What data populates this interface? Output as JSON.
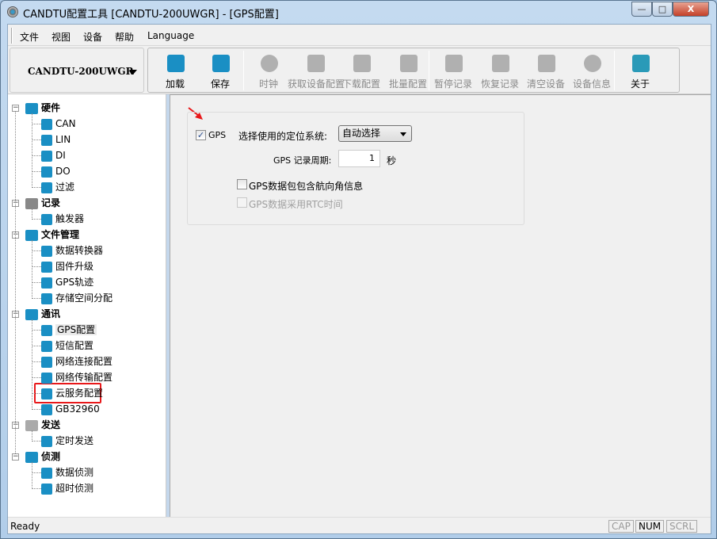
{
  "window": {
    "title": "CANDTU配置工具 [CANDTU-200UWGR] - [GPS配置]",
    "controls": {
      "minimize": "—",
      "maximize": "□",
      "close": "X"
    }
  },
  "menu": [
    "文件",
    "视图",
    "设备",
    "帮助",
    "Language"
  ],
  "device_selector": {
    "value": "CANDTU-200UWGR"
  },
  "toolbar": [
    {
      "label": "加载",
      "icon": "load-icon",
      "enabled": true
    },
    {
      "label": "保存",
      "icon": "save-icon",
      "enabled": true
    },
    {
      "label": "时钟",
      "icon": "clock-icon",
      "enabled": false
    },
    {
      "label": "获取设备配置",
      "icon": "get-config-icon",
      "enabled": false
    },
    {
      "label": "下载配置",
      "icon": "download-config-icon",
      "enabled": false
    },
    {
      "label": "批量配置",
      "icon": "batch-config-icon",
      "enabled": false
    },
    {
      "label": "暂停记录",
      "icon": "pause-icon",
      "enabled": false
    },
    {
      "label": "恢复记录",
      "icon": "play-icon",
      "enabled": false
    },
    {
      "label": "清空设备",
      "icon": "clear-icon",
      "enabled": false
    },
    {
      "label": "设备信息",
      "icon": "info-icon",
      "enabled": false
    },
    {
      "label": "关于",
      "icon": "about-icon",
      "enabled": true
    }
  ],
  "tree": [
    {
      "label": "硬件",
      "children": [
        "CAN",
        "LIN",
        "DI",
        "DO",
        "过滤"
      ]
    },
    {
      "label": "记录",
      "children": [
        "触发器"
      ]
    },
    {
      "label": "文件管理",
      "children": [
        "数据转换器",
        "固件升级",
        "GPS轨迹",
        "存储空间分配"
      ]
    },
    {
      "label": "通讯",
      "children": [
        "GPS配置",
        "短信配置",
        "网络连接配置",
        "网络传输配置",
        "云服务配置",
        "GB32960"
      ]
    },
    {
      "label": "发送",
      "children": [
        "定时发送"
      ]
    },
    {
      "label": "侦测",
      "children": [
        "数据侦测",
        "超时侦测"
      ]
    }
  ],
  "selected_node": "GPS配置",
  "gps": {
    "enable_label": "GPS",
    "enabled": true,
    "system_label": "选择使用的定位系统:",
    "system_value": "自动选择",
    "period_label": "GPS 记录周期:",
    "period_value": "1",
    "period_unit": "秒",
    "heading_label": "GPS数据包包含航向角信息",
    "heading_checked": false,
    "rtc_label": "GPS数据采用RTC时间",
    "rtc_checked": false,
    "rtc_enabled": false
  },
  "status": {
    "text": "Ready",
    "indicators": [
      {
        "label": "CAP",
        "active": false
      },
      {
        "label": "NUM",
        "active": true
      },
      {
        "label": "SCRL",
        "active": false
      }
    ]
  },
  "colors": {
    "accent": "#1a8fc4",
    "highlight": "#e8181a"
  }
}
